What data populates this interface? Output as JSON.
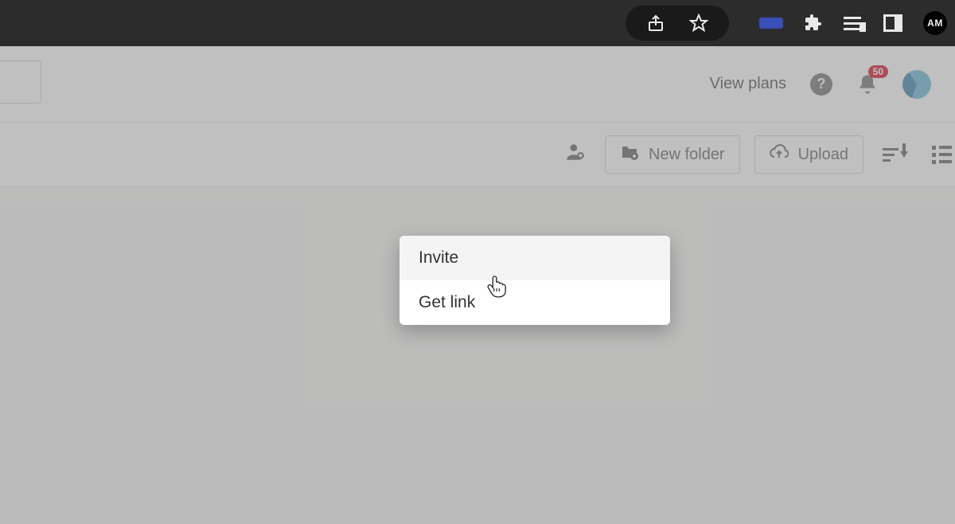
{
  "chrome": {
    "avatar_initials": "AM"
  },
  "header": {
    "view_plans": "View plans",
    "help_glyph": "?",
    "notification_count": "50"
  },
  "toolbar": {
    "new_folder": "New folder",
    "upload": "Upload"
  },
  "dropdown": {
    "invite": "Invite",
    "get_link": "Get link"
  }
}
